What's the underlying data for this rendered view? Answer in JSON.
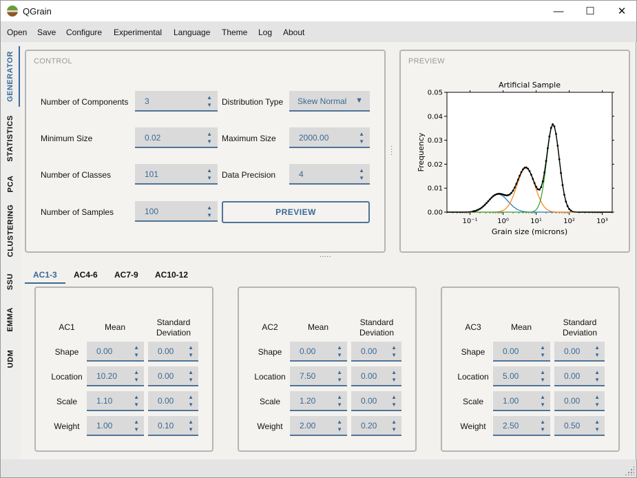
{
  "window": {
    "title": "QGrain",
    "minimize": "—",
    "maximize": "☐",
    "close": "✕"
  },
  "menu": [
    "Open",
    "Save",
    "Configure",
    "Experimental",
    "Language",
    "Theme",
    "Log",
    "About"
  ],
  "sidebar": {
    "tabs": [
      "GENERATOR",
      "STATISTICS",
      "PCA",
      "CLUSTERING",
      "SSU",
      "EMMA",
      "UDM"
    ],
    "active": "GENERATOR"
  },
  "control": {
    "title": "CONTROL",
    "num_components": {
      "label": "Number of Components",
      "value": "3"
    },
    "distribution_type": {
      "label": "Distribution Type",
      "value": "Skew Normal"
    },
    "min_size": {
      "label": "Minimum Size",
      "value": "0.02"
    },
    "max_size": {
      "label": "Maximum Size",
      "value": "2000.00"
    },
    "num_classes": {
      "label": "Number of Classes",
      "value": "101"
    },
    "data_precision": {
      "label": "Data Precision",
      "value": "4"
    },
    "num_samples": {
      "label": "Number of Samples",
      "value": "100"
    },
    "preview_button": "PREVIEW"
  },
  "preview": {
    "title": "PREVIEW",
    "chart_data": {
      "type": "line",
      "title": "Artificial Sample",
      "xlabel": "Grain size (microns)",
      "ylabel": "Frequency",
      "xscale": "log",
      "xlim": [
        0.02,
        2000
      ],
      "ylim": [
        0,
        0.05
      ],
      "x_ticks": [
        "10⁻¹",
        "10⁰",
        "10¹",
        "10²",
        "10³"
      ],
      "y_ticks": [
        "0.00",
        "0.01",
        "0.02",
        "0.03",
        "0.04",
        "0.05"
      ],
      "colors": {
        "sample": "#000000",
        "c1": "#1f77b4",
        "c2": "#ff7f0e",
        "c3": "#2ca02c"
      },
      "series": [
        {
          "mean": -0.15,
          "std": 0.3,
          "weight": 0.0075
        },
        {
          "mean": 0.69,
          "std": 0.27,
          "weight": 0.0185
        },
        {
          "mean": 1.51,
          "std": 0.19,
          "weight": 0.0365
        }
      ]
    }
  },
  "component_tabs": {
    "tabs": [
      "AC1-3",
      "AC4-6",
      "AC7-9",
      "AC10-12"
    ],
    "active": "AC1-3"
  },
  "components": [
    {
      "name": "AC1",
      "mean_h": "Mean",
      "std_h": [
        "Standard",
        "Deviation"
      ],
      "rows": [
        {
          "label": "Shape",
          "mean": "0.00",
          "std": "0.00"
        },
        {
          "label": "Location",
          "mean": "10.20",
          "std": "0.00"
        },
        {
          "label": "Scale",
          "mean": "1.10",
          "std": "0.00"
        },
        {
          "label": "Weight",
          "mean": "1.00",
          "std": "0.10"
        }
      ]
    },
    {
      "name": "AC2",
      "mean_h": "Mean",
      "std_h": [
        "Standard",
        "Deviation"
      ],
      "rows": [
        {
          "label": "Shape",
          "mean": "0.00",
          "std": "0.00"
        },
        {
          "label": "Location",
          "mean": "7.50",
          "std": "0.00"
        },
        {
          "label": "Scale",
          "mean": "1.20",
          "std": "0.00"
        },
        {
          "label": "Weight",
          "mean": "2.00",
          "std": "0.20"
        }
      ]
    },
    {
      "name": "AC3",
      "mean_h": "Mean",
      "std_h": [
        "Standard",
        "Deviation"
      ],
      "rows": [
        {
          "label": "Shape",
          "mean": "0.00",
          "std": "0.00"
        },
        {
          "label": "Location",
          "mean": "5.00",
          "std": "0.00"
        },
        {
          "label": "Scale",
          "mean": "1.00",
          "std": "0.00"
        },
        {
          "label": "Weight",
          "mean": "2.50",
          "std": "0.50"
        }
      ]
    }
  ]
}
